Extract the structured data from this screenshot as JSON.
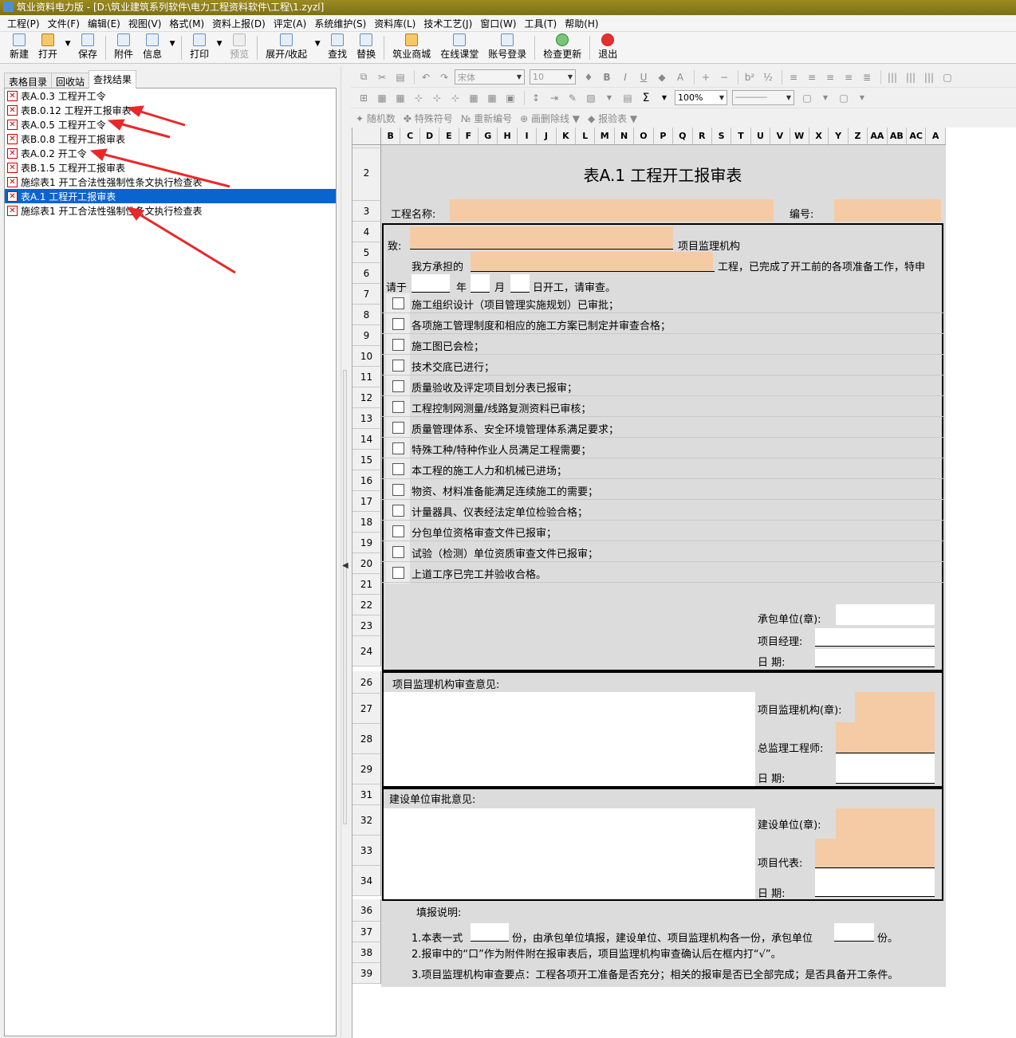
{
  "window": {
    "title": "筑业资料电力版 - [D:\\筑业建筑系列软件\\电力工程资料软件\\工程\\1.zyzl]"
  },
  "menu": [
    "工程(P)",
    "文件(F)",
    "编辑(E)",
    "视图(V)",
    "格式(M)",
    "资料上报(D)",
    "评定(A)",
    "系统维护(S)",
    "资料库(L)",
    "技术工艺(J)",
    "窗口(W)",
    "工具(T)",
    "帮助(H)"
  ],
  "toolbar": {
    "new": "新建",
    "open": "打开",
    "save": "保存",
    "attach": "附件",
    "info": "信息",
    "print": "打印",
    "preview": "预览",
    "expand": "展开/收起",
    "find": "查找",
    "replace": "替换",
    "mall": "筑业商城",
    "classroom": "在线课堂",
    "login": "账号登录",
    "update": "检查更新",
    "exit": "退出"
  },
  "left": {
    "tabs": [
      "表格目录",
      "回收站",
      "查找结果"
    ],
    "active_tab": 2,
    "items": [
      {
        "label": "表A.0.3  工程开工令"
      },
      {
        "label": "表B.0.12 工程开工报审表"
      },
      {
        "label": "表A.0.5  工程开工令"
      },
      {
        "label": "表B.0.8  工程开工报审表"
      },
      {
        "label": "表A.0.2  开工令"
      },
      {
        "label": "表B.1.5  工程开工报审表"
      },
      {
        "label": "施综表1  开工合法性强制性条文执行检查表"
      },
      {
        "label": "表A.1  工程开工报审表"
      },
      {
        "label": "施综表1  开工合法性强制性条文执行检查表"
      }
    ],
    "selected_index": 7
  },
  "format": {
    "font": "宋体",
    "size": "10",
    "zoom": "100%",
    "sigma": "Σ",
    "row3": [
      "随机数",
      "特殊符号",
      "重新编号",
      "画删除线",
      "报验表"
    ]
  },
  "columns": [
    "B",
    "C",
    "D",
    "E",
    "F",
    "G",
    "H",
    "I",
    "J",
    "K",
    "L",
    "M",
    "N",
    "O",
    "P",
    "Q",
    "R",
    "S",
    "T",
    "U",
    "V",
    "W",
    "X",
    "Y",
    "Z",
    "AA",
    "AB",
    "AC",
    "A"
  ],
  "rows": [
    "2",
    "3",
    "4",
    "5",
    "6",
    "7",
    "8",
    "9",
    "10",
    "11",
    "12",
    "13",
    "14",
    "15",
    "16",
    "17",
    "18",
    "19",
    "20",
    "21",
    "22",
    "23",
    "24",
    "26",
    "27",
    "28",
    "29",
    "31",
    "32",
    "33",
    "34",
    "36",
    "37",
    "38",
    "39"
  ],
  "form": {
    "title": "表A.1  工程开工报审表",
    "project_name_label": "工程名称:",
    "number_label": "编号:",
    "to_label": "致:",
    "supervisor_org": "项目监理机构",
    "we_undertake": "我方承担的",
    "prep_done": "工程，已完成了开工前的各项准备工作，特申",
    "please_on": "请于",
    "year": "年",
    "month": "月",
    "start_request": "日开工，请审查。",
    "checklist": [
      "施工组织设计（项目管理实施规划）已审批；",
      "各项施工管理制度和相应的施工方案已制定并审查合格；",
      "施工图已会检；",
      "技术交底已进行；",
      "质量验收及评定项目划分表已报审；",
      "工程控制网测量/线路复测资料已审核；",
      "质量管理体系、安全环境管理体系满足要求；",
      "特殊工种/特种作业人员满足工程需要；",
      "本工程的施工人力和机械已进场；",
      "物资、材料准备能满足连续施工的需要；",
      "计量器具、仪表经法定单位检验合格；",
      "分包单位资格审查文件已报审；",
      "试验（检测）单位资质审查文件已报审；",
      "上道工序已完工并验收合格。"
    ],
    "contractor_label": "承包单位(章):",
    "pm_label": "项目经理:",
    "date_label": "日      期:",
    "sup_opinion": "项目监理机构审查意见:",
    "sup_org_label": "项目监理机构(章):",
    "chief_label": "总监理工程师:",
    "date_label2": "日          期:",
    "owner_opinion": "建设单位审批意见:",
    "owner_label": "建设单位(章):",
    "owner_rep_label": "项目代表:",
    "date_label3": "日      期:",
    "notes_title": "填报说明:",
    "note1a": "1.本表一式",
    "note1b": "份，由承包单位填报，建设单位、项目监理机构各一份，承包单位",
    "note1c": "份。",
    "note2": "2.报审中的“口”作为附件附在报审表后，项目监理机构审查确认后在框内打“√”。",
    "note3": "3.项目监理机构审查要点：工程各项开工准备是否充分；相关的报审是否已全部完成；是否具备开工条件。"
  }
}
